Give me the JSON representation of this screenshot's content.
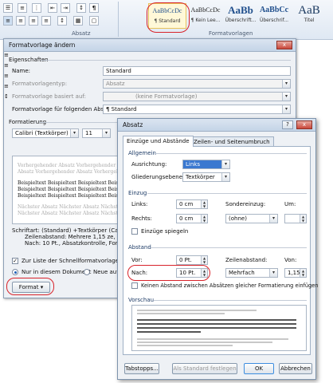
{
  "ribbon": {
    "group_absatz": "Absatz",
    "group_formatvorlagen": "Formatvorlagen",
    "styles": [
      {
        "preview": "AaBbCcDc",
        "caption": "¶ Standard"
      },
      {
        "preview": "AaBbCcDc",
        "caption": "¶ Kein Lee..."
      },
      {
        "preview": "AaBb",
        "caption": "Überschrift..."
      },
      {
        "preview": "AaBbCc",
        "caption": "Überschrif..."
      },
      {
        "preview": "AaB",
        "caption": "Titel"
      }
    ],
    "pilcrow": "¶"
  },
  "dialog1": {
    "title": "Formatvorlage ändern",
    "close": "x",
    "properties_header": "Eigenschaften",
    "name_label": "Name:",
    "name_value": "Standard",
    "type_label": "Formatvorlagentyp:",
    "type_value": "Absatz",
    "based_label": "Formatvorlage basiert auf:",
    "based_value": "(keine Formatvorlage)",
    "next_label": "Formatvorlage für folgenden Absatz:",
    "next_value": "¶ Standard",
    "format_header": "Formatierung",
    "font_value": "Calibri (Textkörper)",
    "size_value": "11",
    "preview_prev": [
      "Vorhergehender Absatz Vorhergehender Absatz Vorhergehender Absatz Vorhergehender",
      "Absatz Vorhergehender Absatz Vorhergehender Absatz Vorhergehender Absatz"
    ],
    "preview_sample": [
      "Beispieltext Beispieltext Beispieltext Beispieltext Beispieltext",
      "Beispieltext Beispieltext Beispieltext Beispieltext Beispieltext",
      "Beispieltext Beispieltext Beispieltext Beispieltext Beispieltext"
    ],
    "preview_next": [
      "Nächster Absatz Nächster Absatz Nächster Absatz Nächster Absatz",
      "Nächster Absatz Nächster Absatz Nächster Absatz Nächster Absatz"
    ],
    "description": [
      "Schriftart: (Standard) +Textkörper (Calibri), L",
      "Zeilenabstand: Mehrere 1,15 ze, Abstand",
      "Nach: 10 Pt., Absatzkontrolle, Formatvorl"
    ],
    "add_to_list": "Zur Liste der Schnellformatvorlagen hinzufüg",
    "only_this_doc": "Nur in diesem Dokument",
    "new_docs": "Neue auf dieser",
    "format_button": "Format ▾"
  },
  "dialog2": {
    "title": "Absatz",
    "help": "?",
    "close": "x",
    "tab1": "Einzüge und Abstände",
    "tab2": "Zeilen- und Seitenumbruch",
    "allgemein": "Allgemein",
    "ausrichtung_label": "Ausrichtung:",
    "ausrichtung_value": "Links",
    "gliederung_label": "Gliederungsebene:",
    "gliederung_value": "Textkörper",
    "einzug": "Einzug",
    "links_label": "Links:",
    "links_value": "0 cm",
    "rechts_label": "Rechts:",
    "rechts_value": "0 cm",
    "sondereinzug_label": "Sondereinzug:",
    "sondereinzug_value": "(ohne)",
    "um_label": "Um:",
    "spiegeln": "Einzüge spiegeln",
    "abstand": "Abstand",
    "vor_label": "Vor:",
    "vor_value": "0 Pt.",
    "nach_label": "Nach:",
    "nach_value": "10 Pt.",
    "zeilenabstand_label": "Zeilenabstand:",
    "zeilenabstand_value": "Mehrfach",
    "von_label": "Von:",
    "von_value": "1,15",
    "kein_abstand": "Keinen Abstand zwischen Absätzen gleicher Formatierung einfügen",
    "vorschau": "Vorschau",
    "tabstopps": "Tabstopps...",
    "als_standard": "Als Standard festlegen",
    "ok": "OK",
    "abbrechen": "Abbrechen"
  }
}
